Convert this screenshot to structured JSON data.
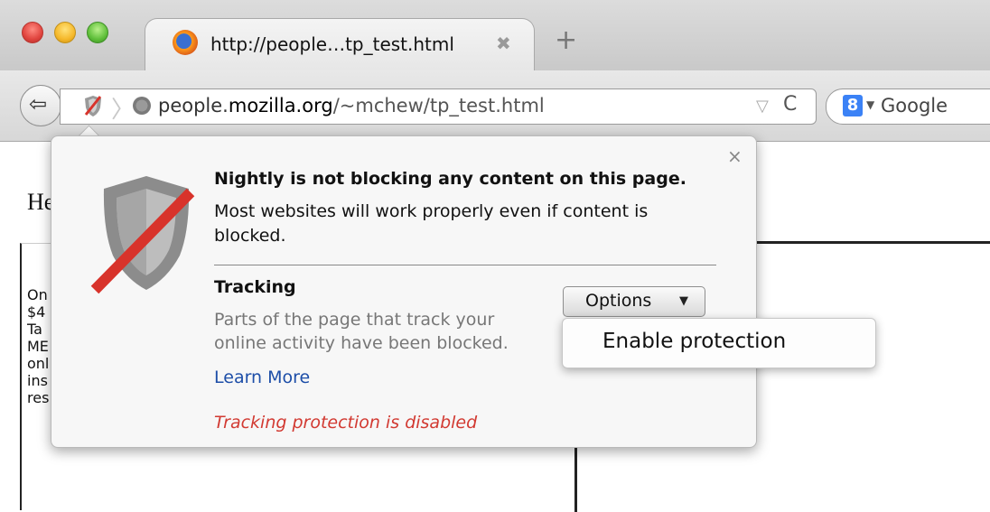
{
  "tab": {
    "title": "http://people…tp_test.html",
    "close_glyph": "✖",
    "new_tab_glyph": "+"
  },
  "nav": {
    "back_glyph": "⇦",
    "url": {
      "prefix": "people.",
      "host": "mozilla.org",
      "path": "/~mchew/tp_test.html"
    },
    "dropdown_glyph": "▽",
    "reload_glyph": "C",
    "search": {
      "engine_badge": "8",
      "placeholder": "Google"
    }
  },
  "page": {
    "heading": "He",
    "ad_lines": "On\n$4\nTa\nME\nonl\nins\nres"
  },
  "panel": {
    "close_glyph": "×",
    "title": "Nightly is not blocking any content on this page.",
    "description": "Most websites will work properly even if content is blocked.",
    "tracking": {
      "heading": "Tracking",
      "description": "Parts of the page that track your online activity have been blocked.",
      "learn_more": "Learn More",
      "options_label": "Options",
      "options_caret": "▼"
    },
    "status": "Tracking protection is disabled"
  },
  "menu": {
    "items": [
      "Enable protection"
    ]
  },
  "colors": {
    "status_red": "#d23a32",
    "link_blue": "#1d4ea8",
    "shield_slash": "#d8332b"
  },
  "icons": [
    "shield-icon",
    "globe-icon",
    "reload-icon",
    "search-engine-icon",
    "close-icon",
    "back-arrow-icon",
    "firefox-icon"
  ]
}
